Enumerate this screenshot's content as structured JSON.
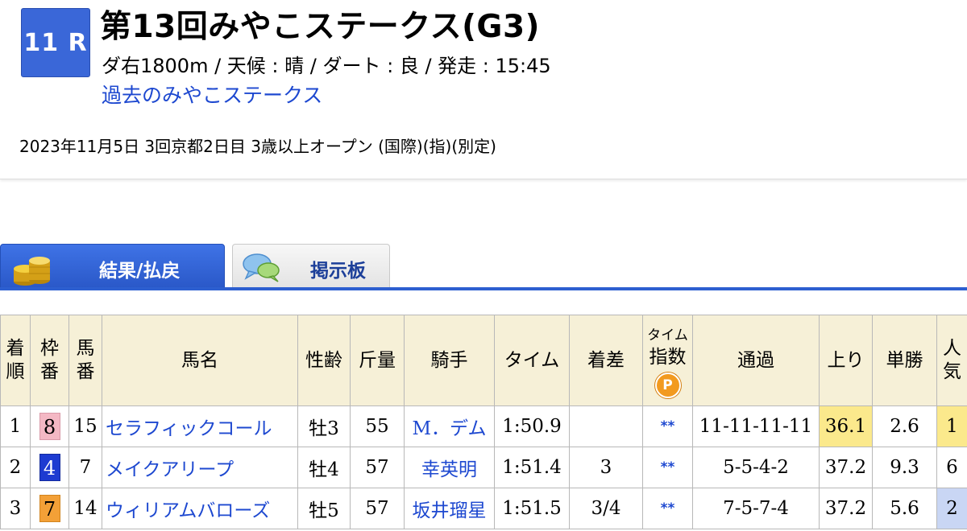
{
  "race": {
    "number_badge": "11 R",
    "title": "第13回みやこステークス(G3)",
    "info": "ダ右1800m / 天候 : 晴 / ダート : 良 / 発走 : 15:45",
    "past_link": "過去のみやこステークス",
    "meta": "2023年11月5日 3回京都2日目 3歳以上オープン  (国際)(指)(別定)"
  },
  "tabs": [
    {
      "label": "結果/払戻",
      "icon": "coin-stack-icon",
      "active": true
    },
    {
      "label": "掲示板",
      "icon": "speech-bubbles-icon",
      "active": false
    }
  ],
  "table": {
    "headers": {
      "rank_line1": "着",
      "rank_line2": "順",
      "waku_line1": "枠",
      "waku_line2": "番",
      "umaban_line1": "馬",
      "umaban_line2": "番",
      "horse": "馬名",
      "sexage": "性齢",
      "weight": "斤量",
      "jockey": "騎手",
      "time": "タイム",
      "margin": "着差",
      "timeidx_line1": "タイム",
      "timeidx_line2": "指数",
      "timeidx_badge": "P",
      "passing": "通過",
      "last3f": "上り",
      "odds": "単勝",
      "pop_line1": "人",
      "pop_line2": "気"
    },
    "rows": [
      {
        "rank": "1",
        "waku": "8",
        "umaban": "15",
        "horse": "セラフィックコール",
        "sexage": "牡3",
        "weight": "55",
        "jockey": "M．デム",
        "time": "1:50.9",
        "margin": "",
        "timeidx": "**",
        "passing": "11-11-11-11",
        "last3f": "36.1",
        "odds": "2.6",
        "pop": "1"
      },
      {
        "rank": "2",
        "waku": "4",
        "umaban": "7",
        "horse": "メイクアリープ",
        "sexage": "牡4",
        "weight": "57",
        "jockey": "幸英明",
        "time": "1:51.4",
        "margin": "3",
        "timeidx": "**",
        "passing": "5-5-4-2",
        "last3f": "37.2",
        "odds": "9.3",
        "pop": "6"
      },
      {
        "rank": "3",
        "waku": "7",
        "umaban": "14",
        "horse": "ウィリアムバローズ",
        "sexage": "牡5",
        "weight": "57",
        "jockey": "坂井瑠星",
        "time": "1:51.5",
        "margin": "3/4",
        "timeidx": "**",
        "passing": "7-5-7-4",
        "last3f": "37.2",
        "odds": "5.6",
        "pop": "2"
      }
    ]
  },
  "colors": {
    "badge": "#3a67d8",
    "link": "#1d48d0",
    "header_bg": "#f6f0d7",
    "waku_8": "#f4b8c4",
    "waku_4": "#1d3bd1",
    "waku_7": "#f3a037",
    "highlight_yellow": "#fbe98c",
    "highlight_blue": "#c9d6f4"
  }
}
